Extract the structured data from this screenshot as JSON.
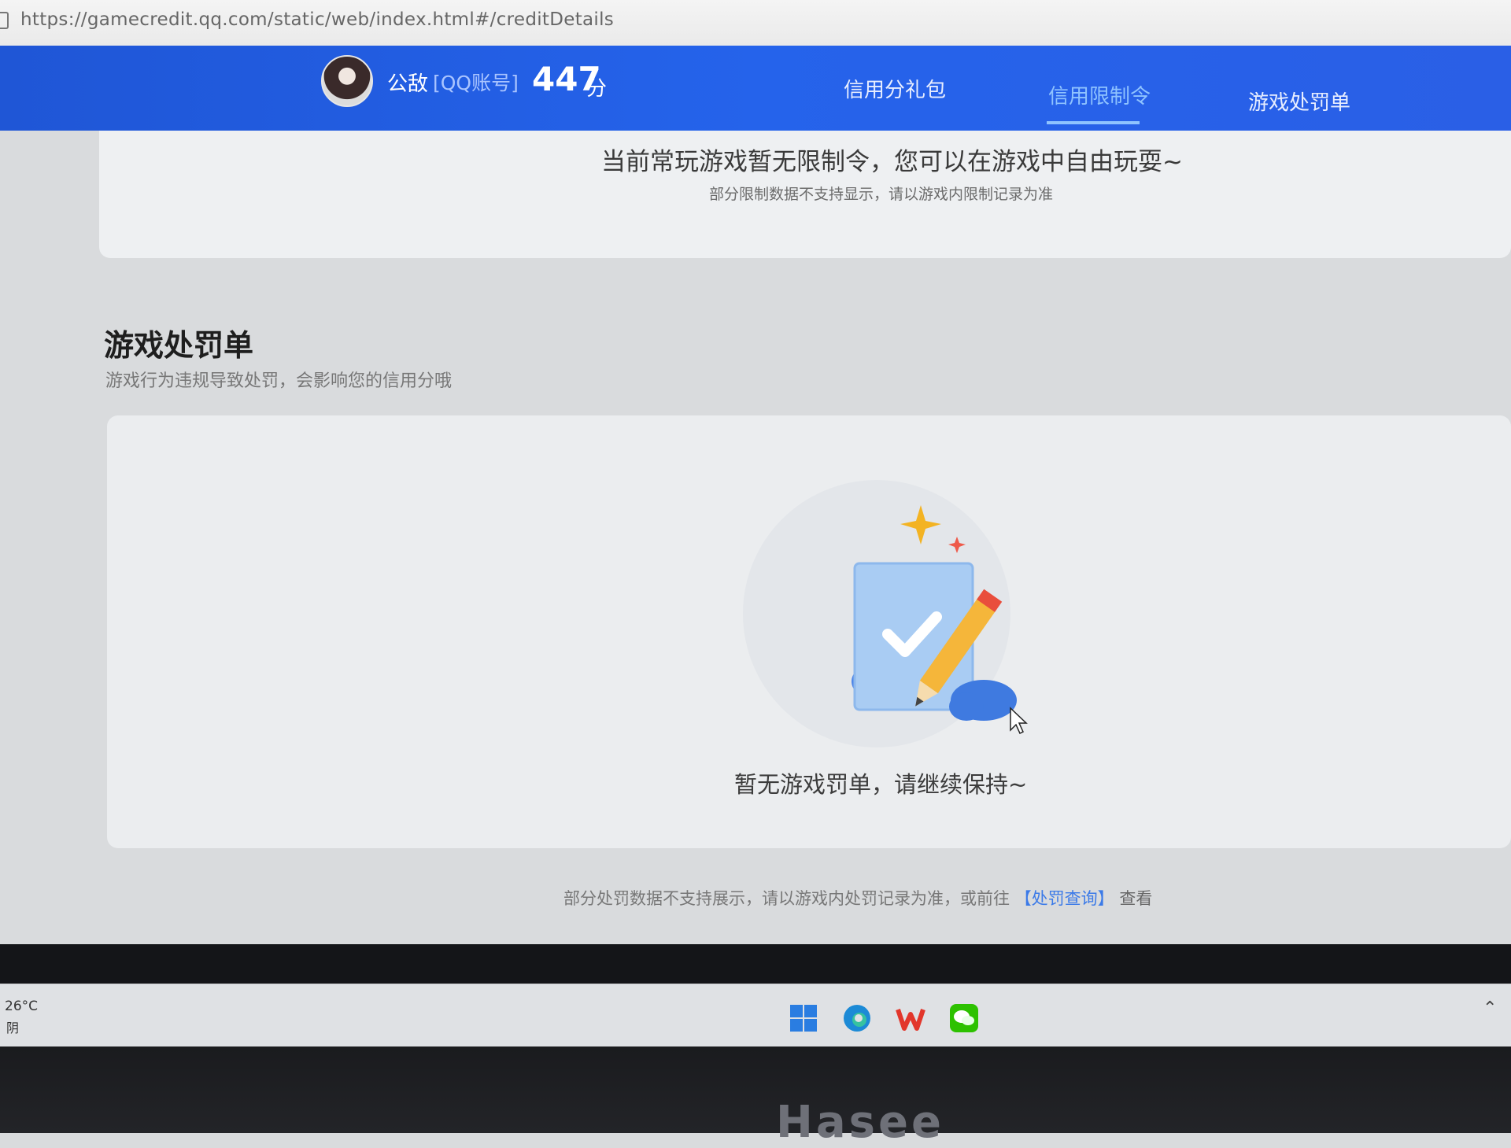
{
  "browser": {
    "url": "https://gamecredit.qq.com/static/web/index.html#/creditDetails"
  },
  "header": {
    "nickname": "公敌",
    "account_type": "[QQ账号]",
    "score": "447",
    "score_unit": "分",
    "tabs": [
      {
        "label": "信用分礼包",
        "active": false
      },
      {
        "label": "信用限制令",
        "active": true
      },
      {
        "label": "游戏处罚单",
        "active": false
      }
    ]
  },
  "restriction": {
    "message": "当前常玩游戏暂无限制令，您可以在游戏中自由玩耍~",
    "note": "部分限制数据不支持显示，请以游戏内限制记录为准"
  },
  "punishment": {
    "title": "游戏处罚单",
    "subtitle": "游戏行为违规导致处罚，会影响您的信用分哦",
    "empty_message": "暂无游戏罚单，请继续保持~",
    "footer_note": "部分处罚数据不支持展示，请以游戏内处罚记录为准，或前往",
    "footer_link": "【处罚查询】",
    "footer_tail": "查看"
  },
  "taskbar": {
    "weather_temp": "26°C",
    "weather_desc": "阴",
    "apps": [
      "windows-start-icon",
      "edge-icon",
      "wps-icon",
      "wechat-icon"
    ]
  },
  "device": {
    "brand": "Hasee"
  },
  "colors": {
    "nav_blue": "#2563eb",
    "active_tab": "#8fc3ff",
    "link": "#3b7ae8"
  }
}
